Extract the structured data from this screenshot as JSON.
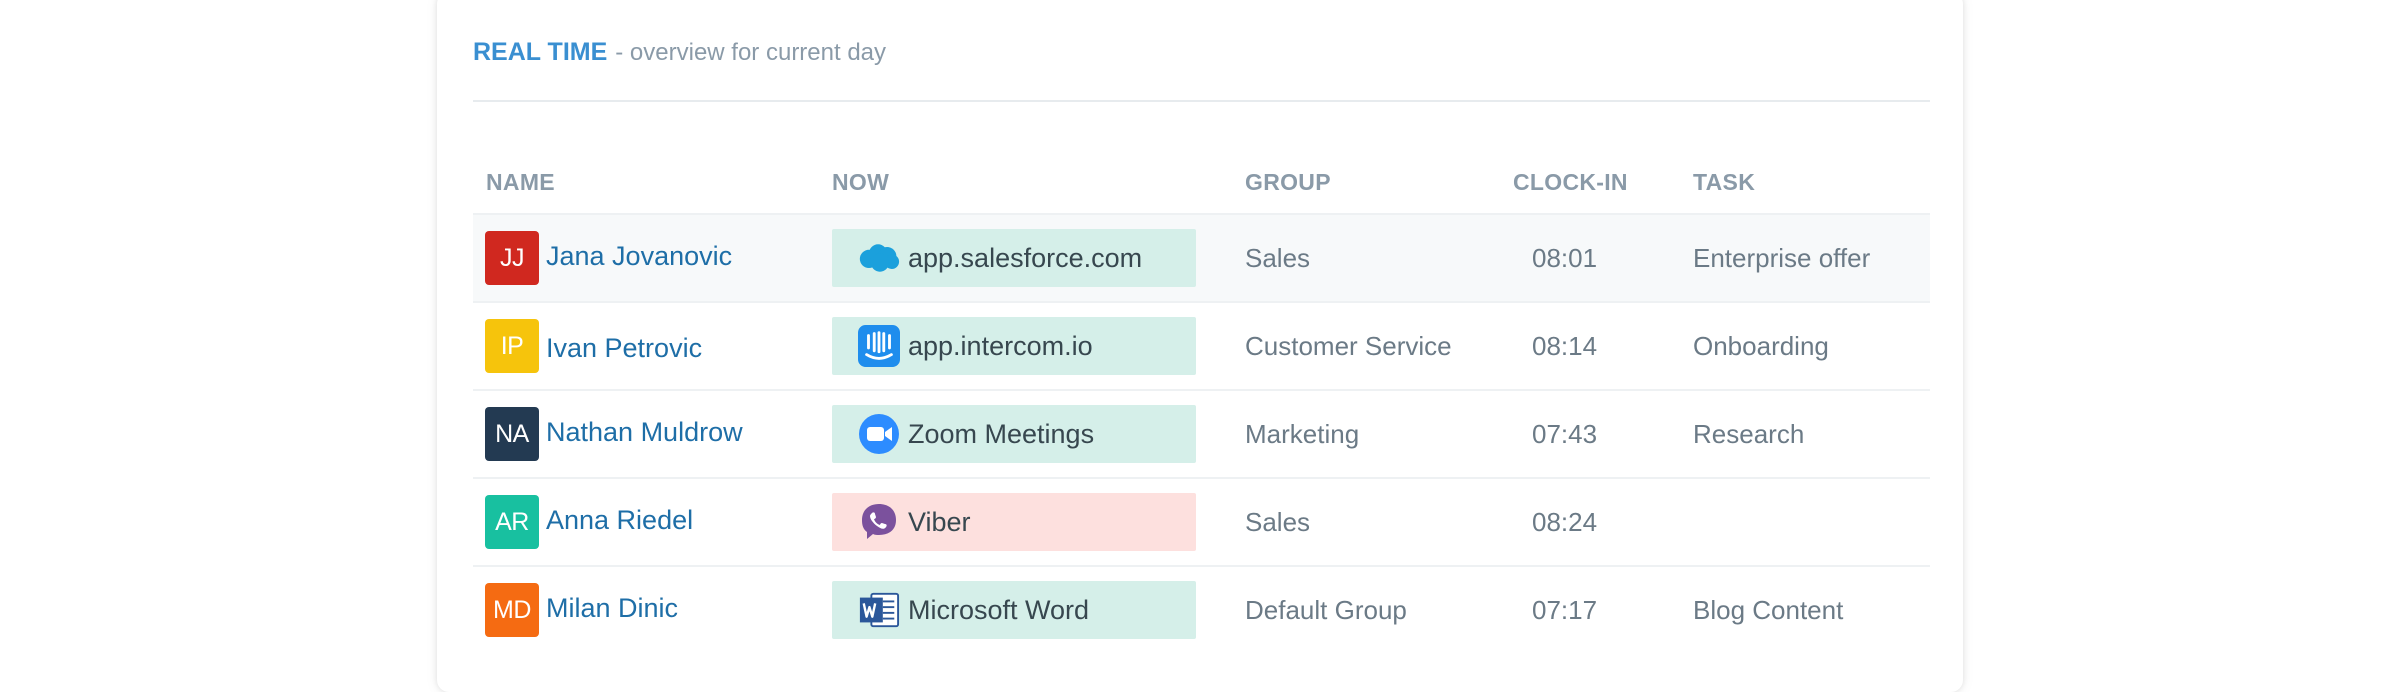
{
  "header": {
    "title": "REAL TIME",
    "subtitle": "- overview for current day"
  },
  "columns": {
    "name": "NAME",
    "now": "NOW",
    "group": "GROUP",
    "clock_in": "CLOCK-IN",
    "task": "TASK"
  },
  "rows": [
    {
      "initials": "JJ",
      "avatar_color": "#d0281f",
      "name": "Jana Jovanovic",
      "now": "app.salesforce.com",
      "now_icon": "salesforce-cloud-icon",
      "now_status": "productive",
      "group": "Sales",
      "clock_in": "08:01",
      "task": "Enterprise offer"
    },
    {
      "initials": "IP",
      "avatar_color": "#f6c40c",
      "name": "Ivan Petrovic",
      "now": "app.intercom.io",
      "now_icon": "intercom-icon",
      "now_status": "productive",
      "group": "Customer Service",
      "clock_in": "08:14",
      "task": "Onboarding"
    },
    {
      "initials": "NA",
      "avatar_color": "#233a52",
      "name": "Nathan Muldrow",
      "now": "Zoom Meetings",
      "now_icon": "zoom-camera-icon",
      "now_status": "productive",
      "group": "Marketing",
      "clock_in": "07:43",
      "task": "Research"
    },
    {
      "initials": "AR",
      "avatar_color": "#18c0a0",
      "name": "Anna Riedel",
      "now": "Viber",
      "now_icon": "viber-phone-icon",
      "now_status": "unproductive",
      "group": "Sales",
      "clock_in": "08:24",
      "task": ""
    },
    {
      "initials": "MD",
      "avatar_color": "#f56b12",
      "name": "Milan Dinic",
      "now": "Microsoft Word",
      "now_icon": "microsoft-word-icon",
      "now_status": "productive",
      "group": "Default Group",
      "clock_in": "07:17",
      "task": "Blog Content"
    }
  ],
  "colors": {
    "productive": "#d5efe9",
    "unproductive": "#fde0de",
    "accent": "#3a8fd1",
    "link": "#1e6ea7"
  }
}
